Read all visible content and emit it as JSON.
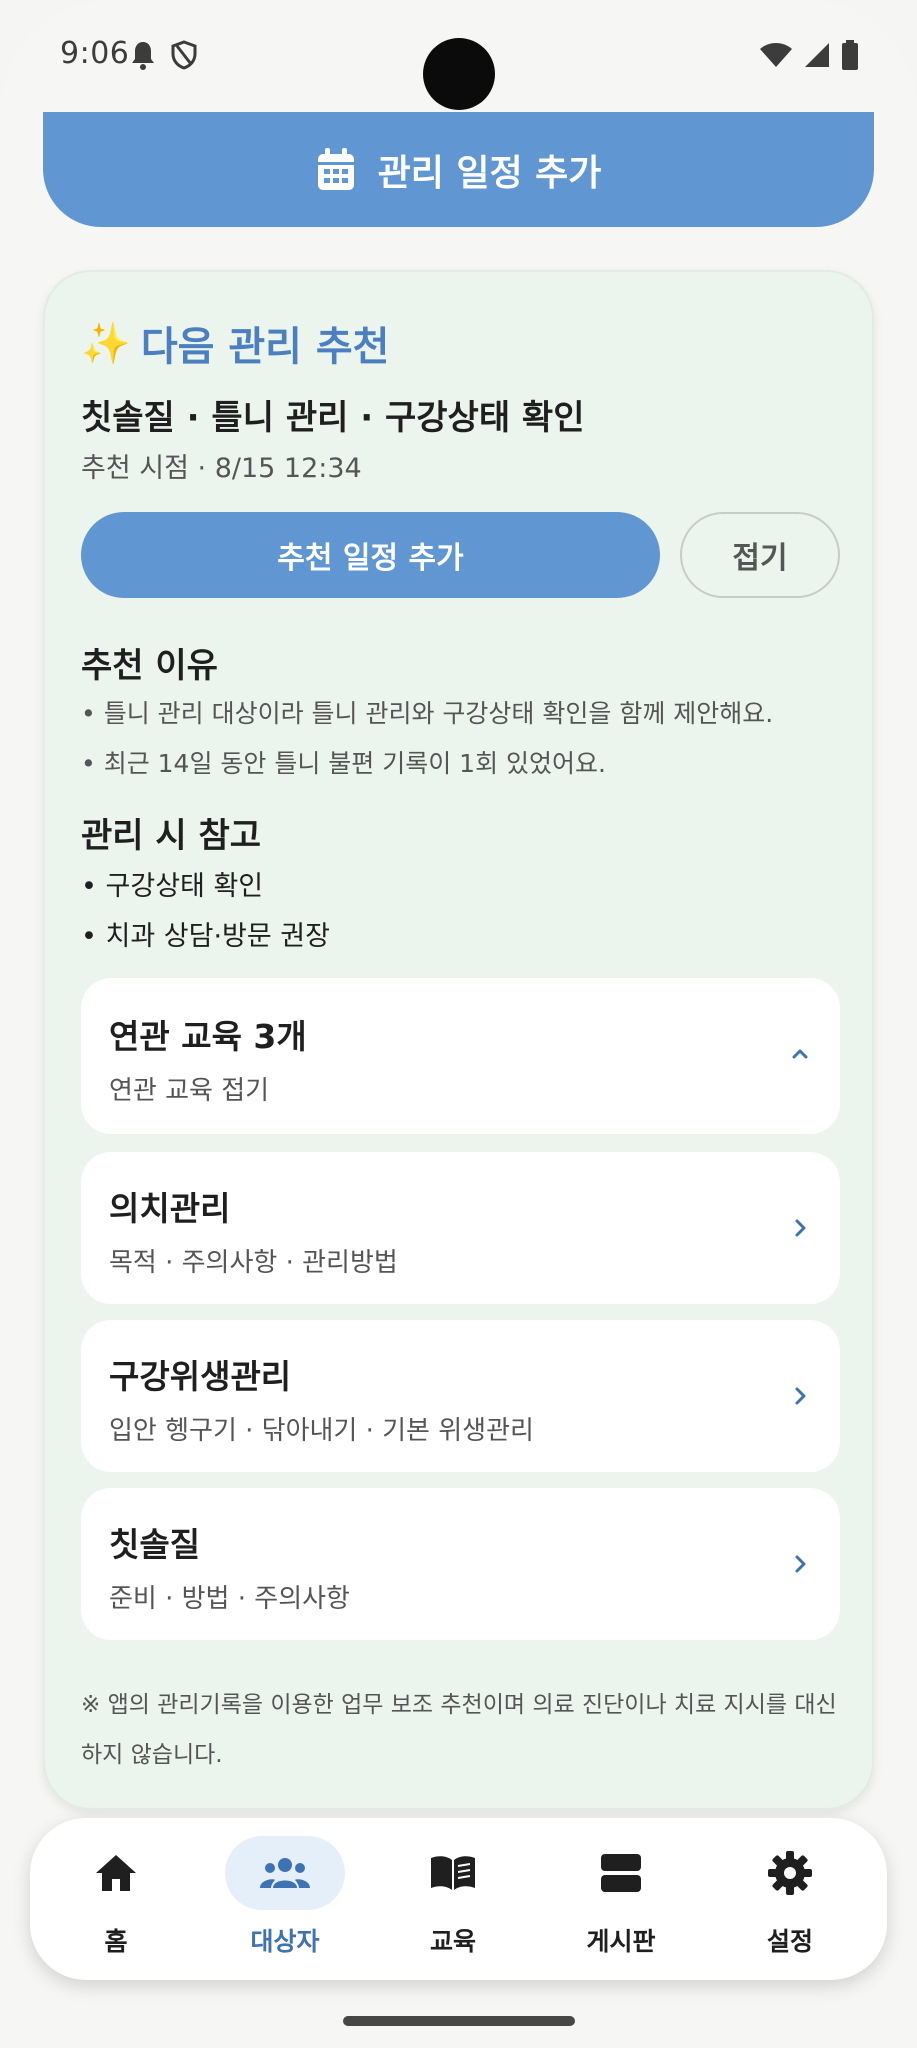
{
  "status_bar": {
    "time": "9:06"
  },
  "top_button": {
    "label": "관리 일정 추가"
  },
  "recommendation": {
    "heading": "다음 관리 추천",
    "title": "칫솔질 · 틀니 관리 · 구강상태 확인",
    "time": "추천 시점 · 8/15 12:34",
    "add_button_label": "추천 일정 추가",
    "collapse_label": "접기",
    "reason_title": "추천 이유",
    "reasons": [
      "• 틀니 관리 대상이라 틀니 관리와 구강상태 확인을 함께 제안해요.",
      "• 최근 14일 동안 틀니 불편 기록이 1회 있었어요."
    ],
    "notes_title": "관리 시 참고",
    "notes": [
      "• 구강상태 확인",
      "• 치과 상담·방문 권장"
    ],
    "related": {
      "title": "연관 교육 3개",
      "subtitle": "연관 교육 접기"
    },
    "education_items": [
      {
        "title": "의치관리",
        "subtitle": "목적 · 주의사항 · 관리방법"
      },
      {
        "title": "구강위생관리",
        "subtitle": "입안 헹구기 · 닦아내기 · 기본 위생관리"
      },
      {
        "title": "칫솔질",
        "subtitle": "준비 · 방법 · 주의사항"
      }
    ],
    "disclaimer": "※ 앱의 관리기록을 이용한 업무 보조 추천이며 의료 진단이나 치료 지시를 대신하지 않습니다."
  },
  "bottom_nav": {
    "items": [
      {
        "label": "홈",
        "icon": "home-icon"
      },
      {
        "label": "대상자",
        "icon": "people-icon",
        "active": true
      },
      {
        "label": "교육",
        "icon": "book-icon"
      },
      {
        "label": "게시판",
        "icon": "board-icon"
      },
      {
        "label": "설정",
        "icon": "gear-icon"
      }
    ]
  },
  "colors": {
    "accent": "#6096d2",
    "card_bg": "#ebf5ee",
    "active_nav": "#3f72b3"
  }
}
